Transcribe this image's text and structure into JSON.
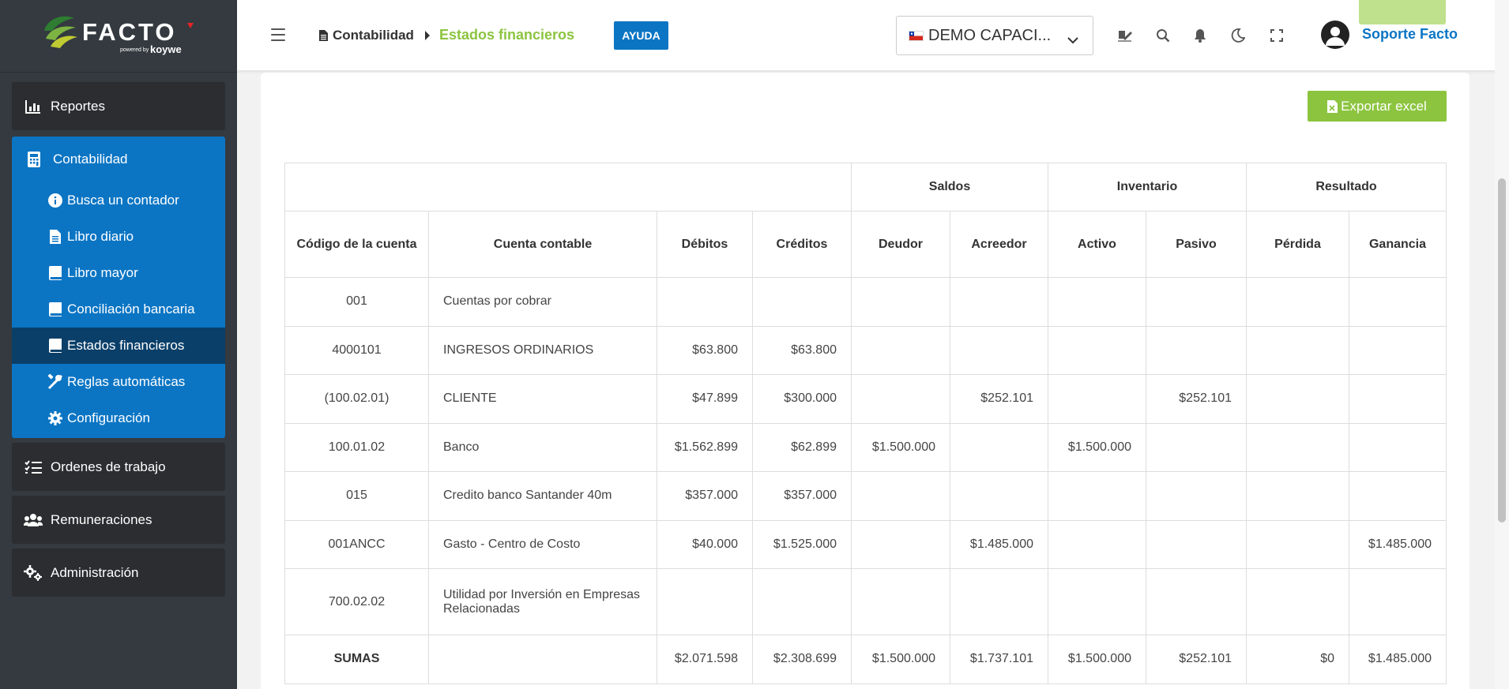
{
  "brand": {
    "name": "FACTO",
    "powered": "powered by",
    "sub": "koywe",
    "accent": "#e52424",
    "green": "#8cc43f"
  },
  "sidebar": {
    "items_before": [
      {
        "label": "Reportes",
        "icon": "bar-chart-icon"
      }
    ],
    "group": {
      "label": "Contabilidad",
      "icon": "calculator-icon",
      "items": [
        {
          "label": "Busca un contador",
          "icon": "info-icon"
        },
        {
          "label": "Libro diario",
          "icon": "file-icon"
        },
        {
          "label": "Libro mayor",
          "icon": "book-icon"
        },
        {
          "label": "Conciliación bancaria",
          "icon": "book-icon"
        },
        {
          "label": "Estados financieros",
          "icon": "book-icon",
          "active": true
        },
        {
          "label": "Reglas automáticas",
          "icon": "tools-icon"
        },
        {
          "label": "Configuración",
          "icon": "gear-icon"
        }
      ]
    },
    "items_after": [
      {
        "label": "Ordenes de trabajo",
        "icon": "tasks-icon"
      },
      {
        "label": "Remuneraciones",
        "icon": "users-icon"
      },
      {
        "label": "Administración",
        "icon": "gears-icon"
      }
    ]
  },
  "header": {
    "breadcrumb_section": "Contabilidad",
    "breadcrumb_page": "Estados financieros",
    "help_label": "AYUDA",
    "company_selected": "DEMO CAPACI...",
    "user_name": "Soporte Facto"
  },
  "main": {
    "export_label": "Exportar excel",
    "table": {
      "groups": [
        "Saldos",
        "Inventario",
        "Resultado"
      ],
      "columns": [
        "Código de la cuenta",
        "Cuenta contable",
        "Débitos",
        "Créditos",
        "Deudor",
        "Acreedor",
        "Activo",
        "Pasivo",
        "Pérdida",
        "Ganancia"
      ],
      "rows": [
        [
          "001",
          "Cuentas por cobrar",
          "",
          "",
          "",
          "",
          "",
          "",
          "",
          ""
        ],
        [
          "4000101",
          "INGRESOS ORDINARIOS",
          "$63.800",
          "$63.800",
          "",
          "",
          "",
          "",
          "",
          ""
        ],
        [
          "(100.02.01)",
          "CLIENTE",
          "$47.899",
          "$300.000",
          "",
          "$252.101",
          "",
          "$252.101",
          "",
          ""
        ],
        [
          "100.01.02",
          "Banco",
          "$1.562.899",
          "$62.899",
          "$1.500.000",
          "",
          "$1.500.000",
          "",
          "",
          ""
        ],
        [
          "015",
          "Credito banco Santander 40m",
          "$357.000",
          "$357.000",
          "",
          "",
          "",
          "",
          "",
          ""
        ],
        [
          "001ANCC",
          "Gasto - Centro de Costo",
          "$40.000",
          "$1.525.000",
          "",
          "$1.485.000",
          "",
          "",
          "",
          "$1.485.000"
        ],
        [
          "700.02.02",
          "Utilidad por Inversión en Empresas Relacionadas",
          "",
          "",
          "",
          "",
          "",
          "",
          "",
          ""
        ]
      ],
      "totals": [
        "SUMAS",
        "",
        "$2.071.598",
        "$2.308.699",
        "$1.500.000",
        "$1.737.101",
        "$1.500.000",
        "$252.101",
        "$0",
        "$1.485.000"
      ]
    }
  }
}
